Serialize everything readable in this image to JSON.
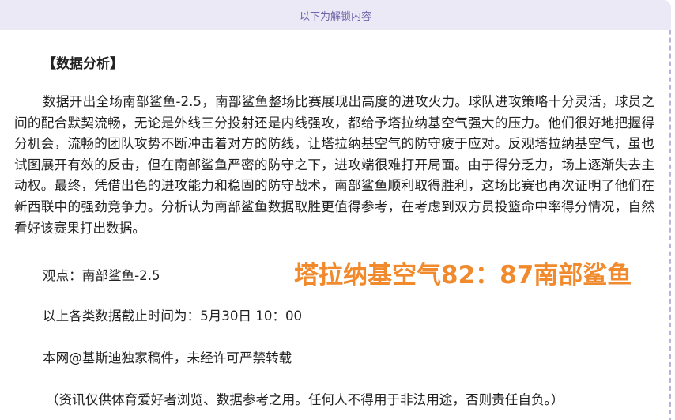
{
  "unlock_banner": "以下为解锁内容",
  "heading": "【数据分析】",
  "analysis_paragraph": "数据开出全场南部鲨鱼-2.5，南部鲨鱼整场比赛展现出高度的进攻火力。球队进攻策略十分灵活，球员之间的配合默契流畅，无论是外线三分投射还是内线强攻，都给予塔拉纳基空气强大的压力。他们很好地把握得分机会，流畅的团队攻势不断冲击着对方的防线，让塔拉纳基空气的防守疲于应对。反观塔拉纳基空气，虽也试图展开有效的反击，但在南部鲨鱼严密的防守之下，进攻端很难打开局面。由于得分乏力，场上逐渐失去主动权。最终，凭借出色的进攻能力和稳固的防守战术，南部鲨鱼顺利取得胜利，这场比赛也再次证明了他们在新西联中的强劲竞争力。分析认为南部鲨鱼数据取胜更值得参考，在考虑到双方员投篮命中率得分情况，自然看好该赛果打出数据。",
  "viewpoint": "观点：南部鲨鱼-2.5",
  "score_overlay": "塔拉纳基空气82：87南部鲨鱼",
  "data_cutoff": "以上各类数据截止时间为：5月30日 10：00",
  "copyright": "本网@基斯迪独家稿件，未经许可严禁转载",
  "disclaimer": "（资讯仅供体育爱好者浏览、数据参考之用。任何人不得用于非法用途，否则责任自负。）",
  "colors": {
    "banner_bg": "#ece9f7",
    "banner_text": "#6f67a8",
    "overlay_text": "#f08a2c",
    "border": "#b9b3d8"
  }
}
